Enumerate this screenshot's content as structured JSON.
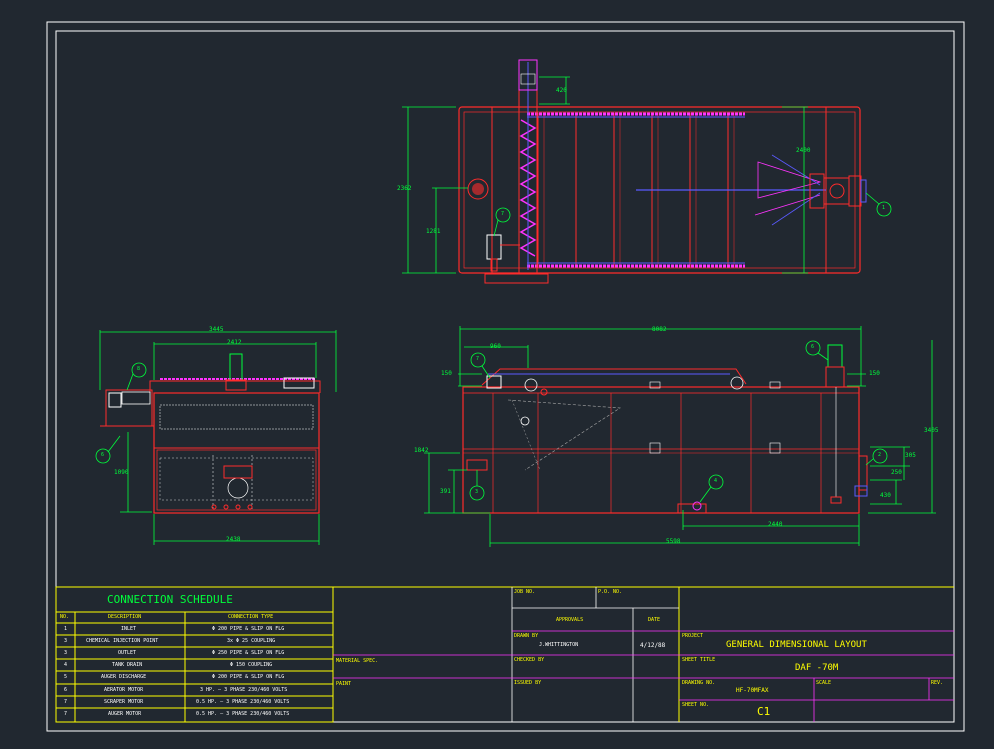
{
  "dimensions": {
    "plan_top": "420",
    "plan_width": "2400",
    "plan_height_total": "2362",
    "plan_height_partial": "1281",
    "end_overall": "3445",
    "end_inner": "2412",
    "end_base": "2438",
    "end_height": "1090",
    "side_overall": "8082",
    "side_offset_left": "960",
    "side_left_top": "150",
    "side_right_top": "150",
    "side_height_total": "3405",
    "side_height_mid": "1842",
    "side_low_left": "391",
    "side_right_a": "305",
    "side_right_b": "250",
    "side_right_c": "430",
    "side_bottom_a": "2440",
    "side_bottom_b": "5598"
  },
  "callouts": {
    "c1": "1",
    "c2": "2",
    "c3": "3",
    "c4": "4",
    "c6a": "6",
    "c6b": "6",
    "c7a": "7",
    "c7b": "7",
    "c8": "8"
  },
  "schedule": {
    "title": "CONNECTION SCHEDULE",
    "headers": [
      "NO.",
      "DESCRIPTION",
      "CONNECTION TYPE"
    ],
    "rows": [
      [
        "1",
        "INLET",
        "Φ 200 PIPE & SLIP ON FLG"
      ],
      [
        "3",
        "CHEMICAL INJECTION POINT",
        "3x Φ 25 COUPLING"
      ],
      [
        "3",
        "OUTLET",
        "Φ 250 PIPE & SLIP ON FLG"
      ],
      [
        "4",
        "TANK DRAIN",
        "Φ 150 COUPLING"
      ],
      [
        "5",
        "AUGER DISCHARGE",
        "Φ 200 PIPE & SLIP ON FLG"
      ],
      [
        "6",
        "AERATOR MOTOR",
        "3 HP. – 3 PHASE 230/460 VOLTS"
      ],
      [
        "7",
        "SCRAPER MOTOR",
        "0.5 HP. – 3 PHASE 230/460 VOLTS"
      ],
      [
        "7",
        "AUGER MOTOR",
        "0.5 HP. – 3 PHASE 230/460 VOLTS"
      ]
    ]
  },
  "title_block": {
    "material_spec": "MATERIAL SPEC.",
    "paint": "PAINT",
    "job_no": "JOB NO.",
    "po_no": "P.O. NO.",
    "approvals": "APPROVALS",
    "date": "DATE",
    "drawn_by": "DRAWN BY",
    "drawn_by_name": "J.WHITTINGTON",
    "drawn_date": "4/12/88",
    "checked_by": "CHECKED BY",
    "issued_by": "ISSUED BY",
    "project": "PROJECT",
    "project_title": "GENERAL DIMENSIONAL LAYOUT",
    "sheet_title": "SHEET TITLE",
    "sheet_title_value": "DAF -70M",
    "drawing_no": "DRAWING NO.",
    "drawing_no_value": "HF-70MFAX",
    "scale": "SCALE",
    "rev": "REV.",
    "sheet_no": "SHEET NO.",
    "sheet_no_value": "C1"
  }
}
